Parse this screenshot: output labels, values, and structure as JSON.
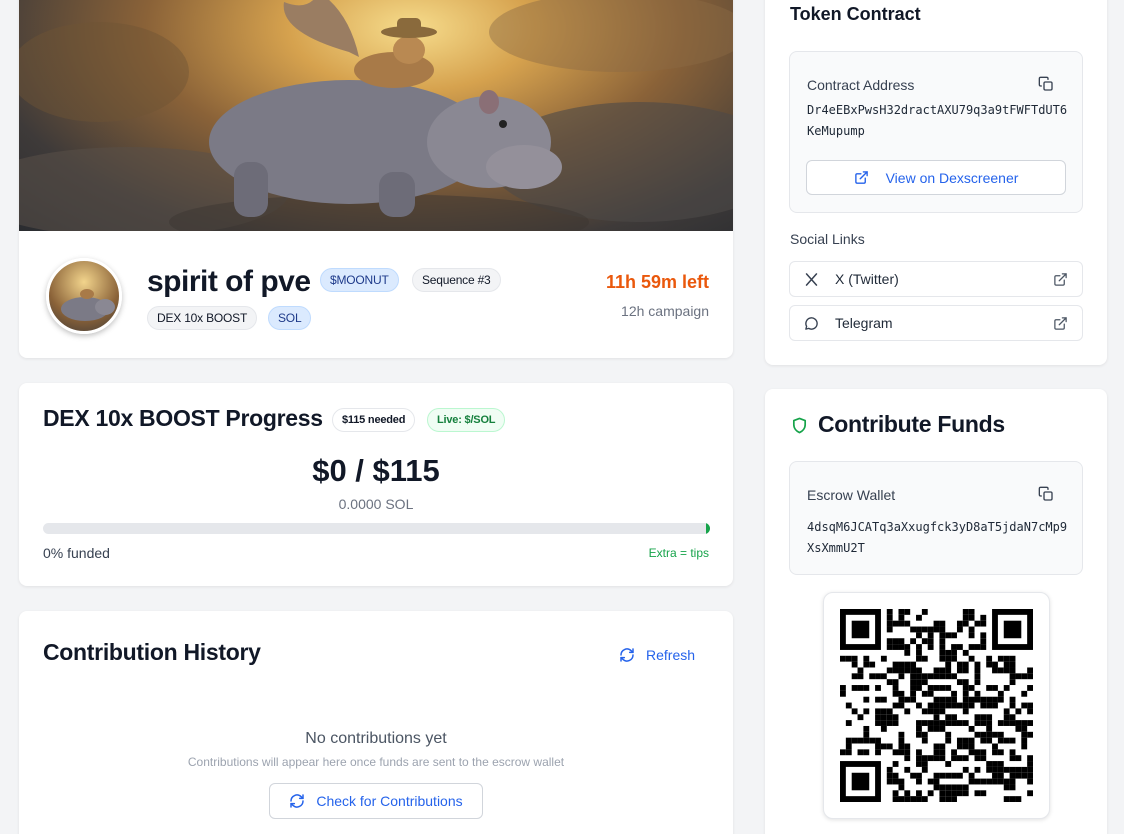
{
  "campaign": {
    "name": "spirit of pve",
    "ticker": "$MOONUT",
    "sequence": "Sequence #3",
    "tags": [
      "DEX 10x BOOST",
      "SOL"
    ],
    "time_left": "11h 59m left",
    "duration": "12h campaign"
  },
  "progress": {
    "title": "DEX 10x BOOST Progress",
    "needed_badge": "$115 needed",
    "live_badge": "Live: $/SOL",
    "amount": "$0 / $115",
    "sol": "0.0000 SOL",
    "percent": 0,
    "funded_label": "0% funded",
    "extra_label": "Extra = tips"
  },
  "history": {
    "title": "Contribution History",
    "refresh_label": "Refresh",
    "empty_title": "No contributions yet",
    "empty_sub": "Contributions will appear here once funds are sent to the escrow wallet",
    "check_label": "Check for Contributions"
  },
  "token_contract": {
    "title": "Token Contract",
    "address_label": "Contract Address",
    "address": "Dr4eEBxPwsH32dractAXU79q3a9tFWFTdUT6KeMupump",
    "dex_label": "View on Dexscreener"
  },
  "social": {
    "title": "Social Links",
    "links": [
      {
        "label": "X (Twitter)",
        "icon": "x-logo-icon"
      },
      {
        "label": "Telegram",
        "icon": "chat-bubble-icon"
      }
    ]
  },
  "contribute": {
    "title": "Contribute Funds",
    "escrow_label": "Escrow Wallet",
    "escrow_address": "4dsqM6JCATq3aXxugfck3yD8aT5jdaN7cMp9XsXmmU2T"
  },
  "colors": {
    "accent_blue": "#2563eb",
    "time_orange": "#ea580c",
    "live_green": "#16a34a"
  }
}
